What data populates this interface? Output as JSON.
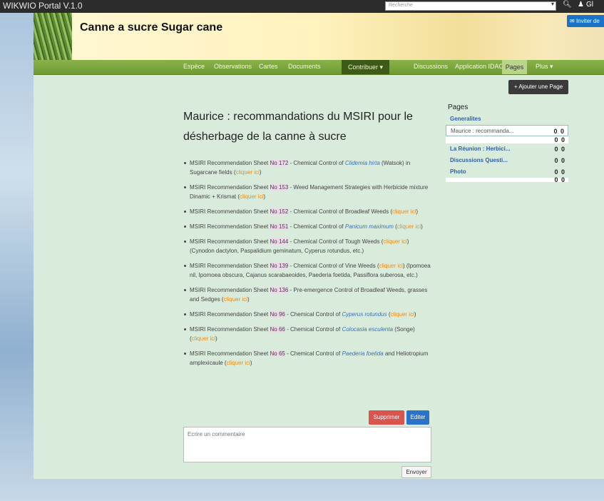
{
  "topbar": {
    "brand": "WIKWIO Portal V.1.0",
    "search_placeholder": "Recherche",
    "search_caret": "▾",
    "search_icon": "magnifier",
    "user_icon": "users-icon",
    "user_label": "Gl"
  },
  "banner": {
    "title": "Canne a sucre Sugar cane",
    "invite_label": "Inviter de"
  },
  "nav": {
    "items": [
      "Espèce",
      "Observations",
      "Cartes",
      "Documents",
      "Contribuer ▾",
      "Discussions",
      "Application IDAO",
      "Pages",
      "Plus ▾"
    ]
  },
  "main": {
    "add_page_label": "Ajouter une Page",
    "article_title": "Maurice : recommandations du MSIRI pour le désherbage de la canne à sucre",
    "references": [
      {
        "pre": "MSIRI Recommendation Sheet ",
        "num": "No 172",
        "mid": " - Chemical Control of ",
        "sp": "Clidemia hirta",
        "post": " (Watsok) in Sugarcane fields (",
        "link": "cliquer ici",
        "end": ")"
      },
      {
        "pre": "MSIRI Recommendation Sheet ",
        "num": "No 153",
        "mid": " - Weed Management Strategies with Herbicide mixture Dinamic + Krismat (",
        "sp": "",
        "post": "",
        "link": "cliquer ici",
        "end": ")"
      },
      {
        "pre": "MSIRI Recommendation Sheet ",
        "num": "No 152",
        "mid": " - Chemical Control of Broadleaf Weeds (",
        "sp": "",
        "post": "",
        "link": "cliquer ici",
        "end": ")"
      },
      {
        "pre": "MSIRI Recommendation Sheet ",
        "num": "No 151",
        "mid": " - Chemical Control of ",
        "sp": "Panicum maximum",
        "post": " (",
        "link": "cliquer ici",
        "end": ")"
      },
      {
        "pre": "MSIRI Recommendation Sheet ",
        "num": "No 144",
        "mid": " - Chemical Control of Tough Weeds (",
        "sp": "",
        "post": "",
        "link": "cliquer ici",
        "end": ") (Cynodon dactylon, Paspalidium geminatum, Cyperus rotundus, etc.)"
      },
      {
        "pre": "MSIRI Recommendation Sheet ",
        "num": "No 139",
        "mid": " - Chemical Control of Vine Weeds (",
        "sp": "",
        "post": "",
        "link": "cliquer ici",
        "end": ") (Ipomoea nil, Ipomoea obscura, Cajanus scarabaeoides, Paederia foetida, Passiflora suberosa, etc.)"
      },
      {
        "pre": "MSIRI Recommendation Sheet ",
        "num": "No 136",
        "mid": " - Pre-emergence Control of Broadleaf Weeds, grasses and Sedges (",
        "sp": "",
        "post": "",
        "link": "cliquer ici",
        "end": ")"
      },
      {
        "pre": "MSIRI Recommendation Sheet ",
        "num": "No 96",
        "mid": " - Chemical Control of ",
        "sp": "Cyperus rotundus",
        "post": " (",
        "link": "cliquer ici",
        "end": ")"
      },
      {
        "pre": "MSIRI Recommendation Sheet ",
        "num": "No 66",
        "mid": " - Chemical Control of ",
        "sp": "Colocasia esculenta",
        "post": " (Songe) (",
        "link": "cliquer ici",
        "end": ")"
      },
      {
        "pre": "MSIRI Recommendation Sheet ",
        "num": "No 65",
        "mid": " - Chemical Control of ",
        "sp": "Paederia foetida",
        "post": " and Heliotropium amplexicaule (",
        "link": "cliquer ici",
        "end": ")"
      }
    ],
    "delete_label": "Supprimer",
    "edit_label": "Editer",
    "comment_placeholder": "Ecrire un commentaire",
    "send_label": "Envoyer"
  },
  "sidebar": {
    "title": "Pages",
    "items": [
      {
        "label": "Generalites",
        "count": ""
      },
      {
        "label": "Maurice : recommanda...",
        "count": "0 0"
      },
      {
        "label": "La Réunion : Herbici...",
        "count": "0 0"
      },
      {
        "label": "Discussions Questi...",
        "count": "0 0"
      },
      {
        "label": "Photo",
        "count": "0 0"
      }
    ],
    "extra_count": "0 0",
    "last_count": "0 0"
  }
}
